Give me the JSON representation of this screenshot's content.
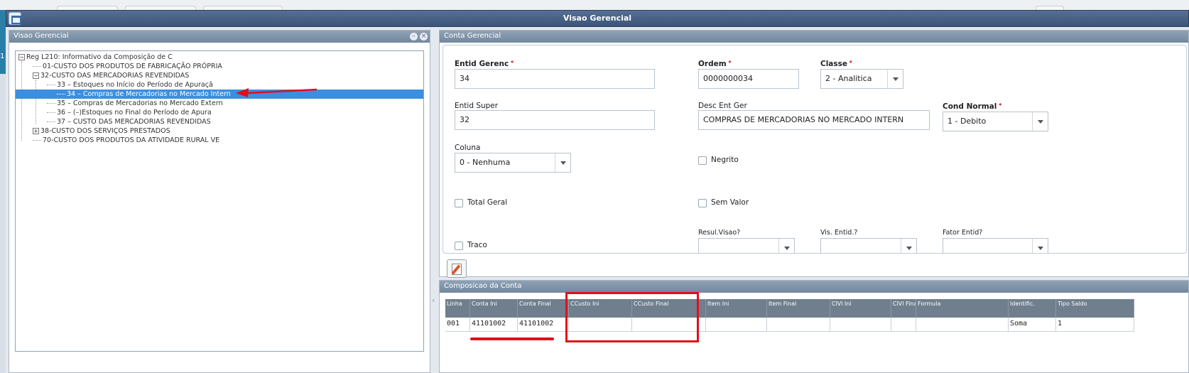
{
  "window": {
    "title": "Visao Gerencial"
  },
  "left_edge_text": "1",
  "tree_panel": {
    "title": "Visao Gerencial",
    "min_label": "–",
    "close_label": "×",
    "nodes": [
      {
        "toggle": "−",
        "label": "Reg L210: Informativo da Composição de C"
      },
      {
        "toggle": "",
        "label": "01-CUSTO DOS PRODUTOS DE FABRICAÇÃO PRÓPRIA"
      },
      {
        "toggle": "−",
        "label": "32-CUSTO DAS MERCADORIAS REVENDIDAS"
      },
      {
        "toggle": "",
        "label": "33 – Estoques no Início do Período de Apuraçã"
      },
      {
        "toggle": "",
        "label": "34 – Compras de Mercadorias no Mercado Intern"
      },
      {
        "toggle": "",
        "label": "35 – Compras de Mercadorias no Mercado Extern"
      },
      {
        "toggle": "",
        "label": "36 – (–)Estoques no Final do Período de Apura"
      },
      {
        "toggle": "",
        "label": "37 – CUSTO DAS MERCADORIAS REVENDIDAS"
      },
      {
        "toggle": "+",
        "label": "38-CUSTO DOS SERVIÇOS PRESTADOS"
      },
      {
        "toggle": "",
        "label": "70-CUSTO DOS PRODUTOS DA ATIVIDADE RURAL VE"
      }
    ],
    "selected_index": 4
  },
  "form_panel": {
    "title": "Conta Gerencial",
    "entid_gerenc": {
      "label": "Entid Gerenc",
      "value": "34"
    },
    "ordem": {
      "label": "Ordem",
      "value": "0000000034"
    },
    "classe": {
      "label": "Classe",
      "value": "2 - Analitica"
    },
    "entid_super": {
      "label": "Entid Super",
      "value": "32"
    },
    "desc_ent_ger": {
      "label": "Desc Ent Ger",
      "value": "COMPRAS DE MERCADORIAS NO MERCADO INTERN"
    },
    "cond_normal": {
      "label": "Cond Normal",
      "value": "1 - Debito"
    },
    "coluna": {
      "label": "Coluna",
      "value": "0 - Nenhuma"
    },
    "negrito": {
      "label": "Negrito",
      "checked": false
    },
    "total_geral": {
      "label": "Total Geral",
      "checked": false
    },
    "sem_valor": {
      "label": "Sem Valor",
      "checked": false
    },
    "traco": {
      "label": "Traco",
      "checked": false
    },
    "resul_visao": {
      "label": "Resul.Visao?",
      "value": ""
    },
    "vis_entid": {
      "label": "Vis. Entid.?",
      "value": ""
    },
    "fator_entid": {
      "label": "Fator Entid?",
      "value": ""
    }
  },
  "composition_panel": {
    "title": "Composicao da Conta",
    "columns": [
      "Linha",
      "Conta Ini",
      "Conta Final",
      "CCusto Ini",
      "CCusto Final",
      "Item Ini",
      "Item Final",
      "ClVl Ini",
      "ClVl Final",
      "Formula",
      "Identific.",
      "Tipo Saldo"
    ],
    "rows": [
      [
        "001",
        "41101002",
        "41101002",
        "",
        "",
        "",
        "",
        "",
        "",
        "",
        "Soma",
        "1"
      ]
    ]
  },
  "collapse_handle": "‹"
}
